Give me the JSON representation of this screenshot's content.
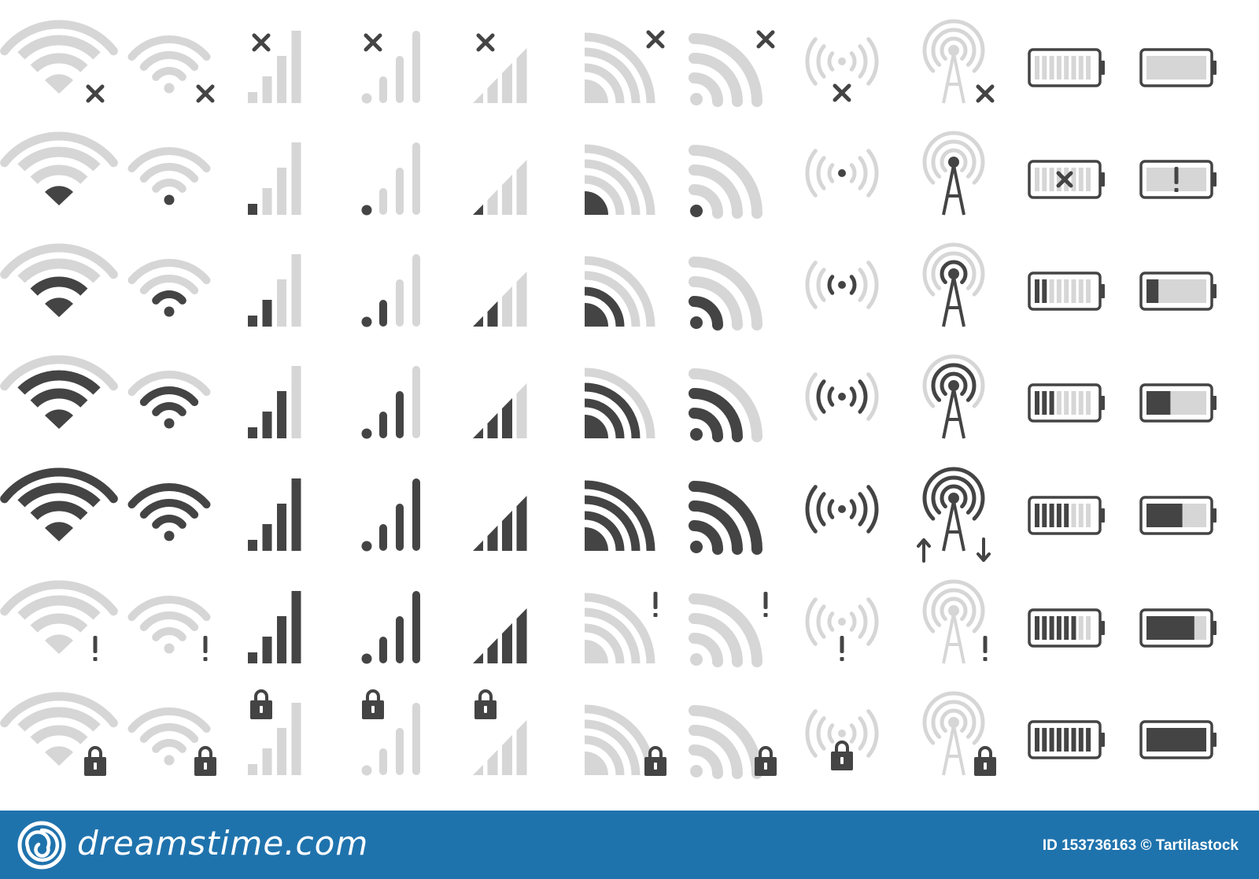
{
  "colors": {
    "active": "#444444",
    "inactive": "#d6d6d6",
    "footer": "#1f73ad"
  },
  "columns": [
    {
      "kind": "wifi-wide",
      "icon_name": "wifi-icon"
    },
    {
      "kind": "wifi-dot",
      "icon_name": "wifi-dot-icon"
    },
    {
      "kind": "bars-square",
      "icon_name": "signal-bars-icon"
    },
    {
      "kind": "bars-dot",
      "icon_name": "signal-bars-dot-icon"
    },
    {
      "kind": "bars-slant",
      "icon_name": "signal-bars-slanted-icon"
    },
    {
      "kind": "rss-quarter",
      "icon_name": "rss-quarter-icon"
    },
    {
      "kind": "rss-dot",
      "icon_name": "rss-feed-icon"
    },
    {
      "kind": "radio",
      "icon_name": "radio-waves-icon"
    },
    {
      "kind": "antenna",
      "icon_name": "antenna-tower-icon"
    },
    {
      "kind": "battery-segments",
      "icon_name": "battery-segments-icon"
    },
    {
      "kind": "battery-fill",
      "icon_name": "battery-fill-icon"
    }
  ],
  "rows": [
    {
      "state": "disconnected",
      "badge": "x-icon",
      "signal_levels": [
        0,
        0,
        0,
        0,
        0,
        0,
        0,
        0,
        0
      ],
      "battery_level": 0.0
    },
    {
      "state": "level-1",
      "badge": "none",
      "signal_levels": [
        1,
        1,
        1,
        1,
        1,
        1,
        1,
        1,
        1
      ],
      "battery_level": 0.0,
      "battery_badges": [
        "x-icon",
        "exclamation-icon"
      ]
    },
    {
      "state": "level-2",
      "badge": "none",
      "signal_levels": [
        2,
        2,
        2,
        2,
        2,
        2,
        2,
        2,
        2
      ],
      "battery_level": 0.2
    },
    {
      "state": "level-3",
      "badge": "none",
      "signal_levels": [
        3,
        3,
        3,
        3,
        3,
        3,
        3,
        3,
        3
      ],
      "battery_level": 0.4
    },
    {
      "state": "full",
      "badge": "none",
      "signal_levels": [
        4,
        4,
        4,
        4,
        4,
        4,
        4,
        4,
        4
      ],
      "battery_level": 0.6,
      "antenna_badge": "up-down-arrows-icon"
    },
    {
      "state": "warning",
      "badge": "exclamation-icon",
      "signal_levels": [
        0,
        0,
        4,
        4,
        4,
        0,
        0,
        0,
        0
      ],
      "battery_level": 0.8
    },
    {
      "state": "locked",
      "badge": "lock-icon",
      "signal_levels": [
        0,
        0,
        0,
        0,
        0,
        0,
        0,
        0,
        0
      ],
      "battery_level": 1.0
    }
  ],
  "footer": {
    "logo_icon": "dreamstime-spiral-logo-icon",
    "brand": "dreamstime.com",
    "stock_info": "ID 153736163 © Tartilastock"
  }
}
